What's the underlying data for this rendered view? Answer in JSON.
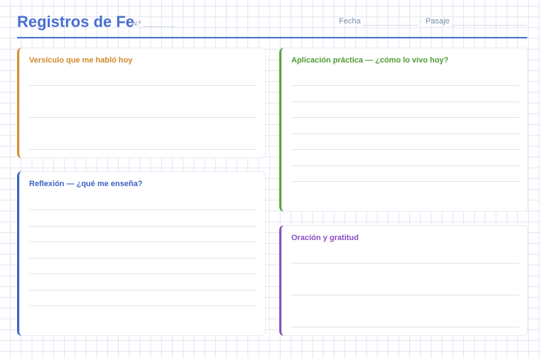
{
  "header": {
    "title": "Registros de Fe",
    "number_label": "N.º",
    "date_label": "Fecha",
    "separator": "·",
    "passage_label": "Pasaje"
  },
  "sections": {
    "versiculo": {
      "title": "Versículo que me habló hoy",
      "color": "#d9902a"
    },
    "reflexion": {
      "title": "Reflexión — ¿qué me enseña?",
      "color": "#3a63c4"
    },
    "aplicacion": {
      "title": "Aplicación práctica — ¿cómo lo vivo hoy?",
      "color": "#5aa33a"
    },
    "oracion": {
      "title": "Oración y gratitud",
      "color": "#8a4fc2"
    }
  }
}
